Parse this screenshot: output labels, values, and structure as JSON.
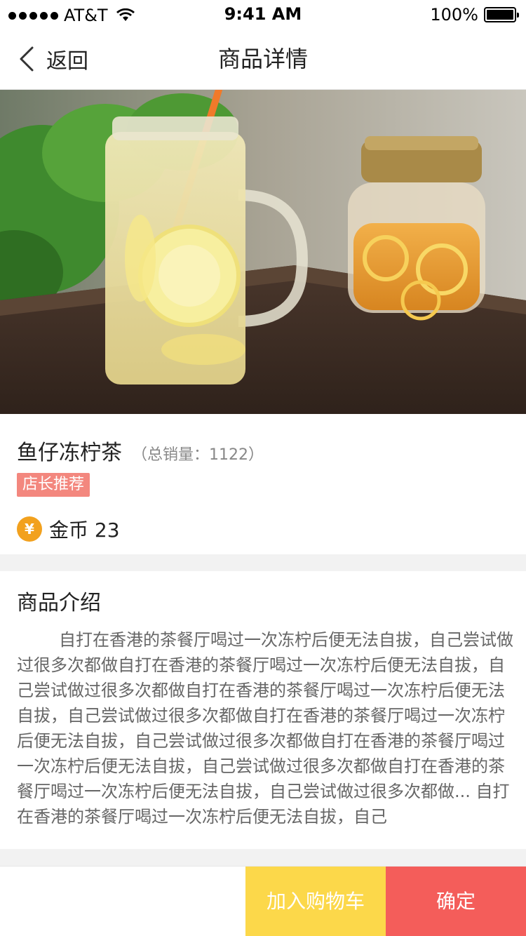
{
  "status_bar": {
    "carrier": "AT&T",
    "time": "9:41 AM",
    "battery": "100%"
  },
  "nav": {
    "back_label": "返回",
    "title": "商品详情"
  },
  "product": {
    "name": "鱼仔冻柠茶",
    "sales": "（总销量：1122）",
    "tag": "店长推荐",
    "coin_symbol": "¥",
    "price": "金币 23"
  },
  "description": {
    "title": "商品介绍",
    "body": "自打在香港的茶餐厅喝过一次冻柠后便无法自拔，自己尝试做过很多次都做自打在香港的茶餐厅喝过一次冻柠后便无法自拔，自己尝试做过很多次都做自打在香港的茶餐厅喝过一次冻柠后便无法自拔，自己尝试做过很多次都做自打在香港的茶餐厅喝过一次冻柠后便无法自拔，自己尝试做过很多次都做自打在香港的茶餐厅喝过一次冻柠后便无法自拔，自己尝试做过很多次都做自打在香港的茶餐厅喝过一次冻柠后便无法自拔，自己尝试做过很多次都做... 自打在香港的茶餐厅喝过一次冻柠后便无法自拔，自己"
  },
  "actions": {
    "add_to_cart": "加入购物车",
    "confirm": "确定"
  },
  "colors": {
    "tag_bg": "#f3877e",
    "coin": "#f2a11e",
    "cart_button": "#fcd84a",
    "confirm_button": "#f45d5a"
  }
}
